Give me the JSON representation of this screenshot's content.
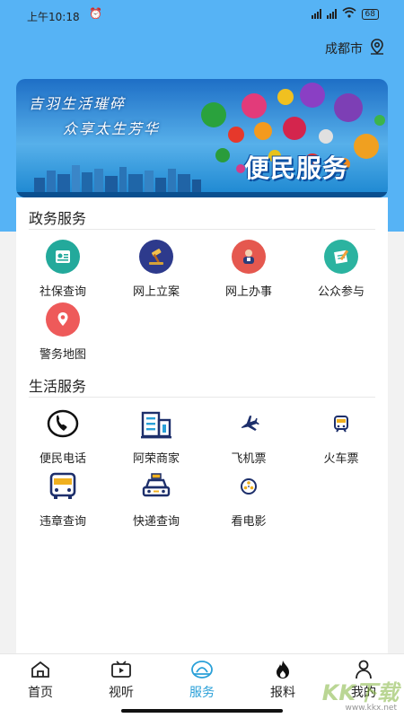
{
  "status_bar": {
    "time": "上午10:18",
    "battery": "68"
  },
  "header": {
    "city": "成都市"
  },
  "banner": {
    "slogan_line1": "吉羽生活璀碎",
    "slogan_line2": "众享太生芳华",
    "title": "便民服务"
  },
  "gov_section": {
    "title": "政务服务",
    "items": [
      {
        "label": "社保查询",
        "icon": "social-security-icon",
        "color": "#23a99b"
      },
      {
        "label": "网上立案",
        "icon": "court-gavel-icon",
        "color": "#2d3a8c"
      },
      {
        "label": "网上办事",
        "icon": "online-affairs-icon",
        "color": "#e5584f"
      },
      {
        "label": "公众参与",
        "icon": "public-participation-icon",
        "color": "#2bb3a0"
      },
      {
        "label": "警务地图",
        "icon": "police-map-icon",
        "color": "#ee5a5a"
      }
    ]
  },
  "life_section": {
    "title": "生活服务",
    "items": [
      {
        "label": "便民电话",
        "icon": "phone-icon"
      },
      {
        "label": "阿荣商家",
        "icon": "merchant-building-icon"
      },
      {
        "label": "飞机票",
        "icon": "airplane-icon"
      },
      {
        "label": "火车票",
        "icon": "train-icon"
      },
      {
        "label": "违章查询",
        "icon": "bus-violation-icon"
      },
      {
        "label": "快递查询",
        "icon": "taxi-delivery-icon"
      },
      {
        "label": "看电影",
        "icon": "film-reel-icon"
      }
    ]
  },
  "tab_bar": {
    "tabs": [
      {
        "label": "首页",
        "icon": "home-icon"
      },
      {
        "label": "视听",
        "icon": "video-icon"
      },
      {
        "label": "服务",
        "icon": "service-icon",
        "active": true
      },
      {
        "label": "报料",
        "icon": "fire-report-icon"
      },
      {
        "label": "我的",
        "icon": "user-icon"
      }
    ]
  },
  "watermark": {
    "text": "KK下载",
    "url": "www.kkx.net"
  },
  "colors": {
    "header_blue": "#56b3f5",
    "active_tab": "#2aa0d8"
  }
}
